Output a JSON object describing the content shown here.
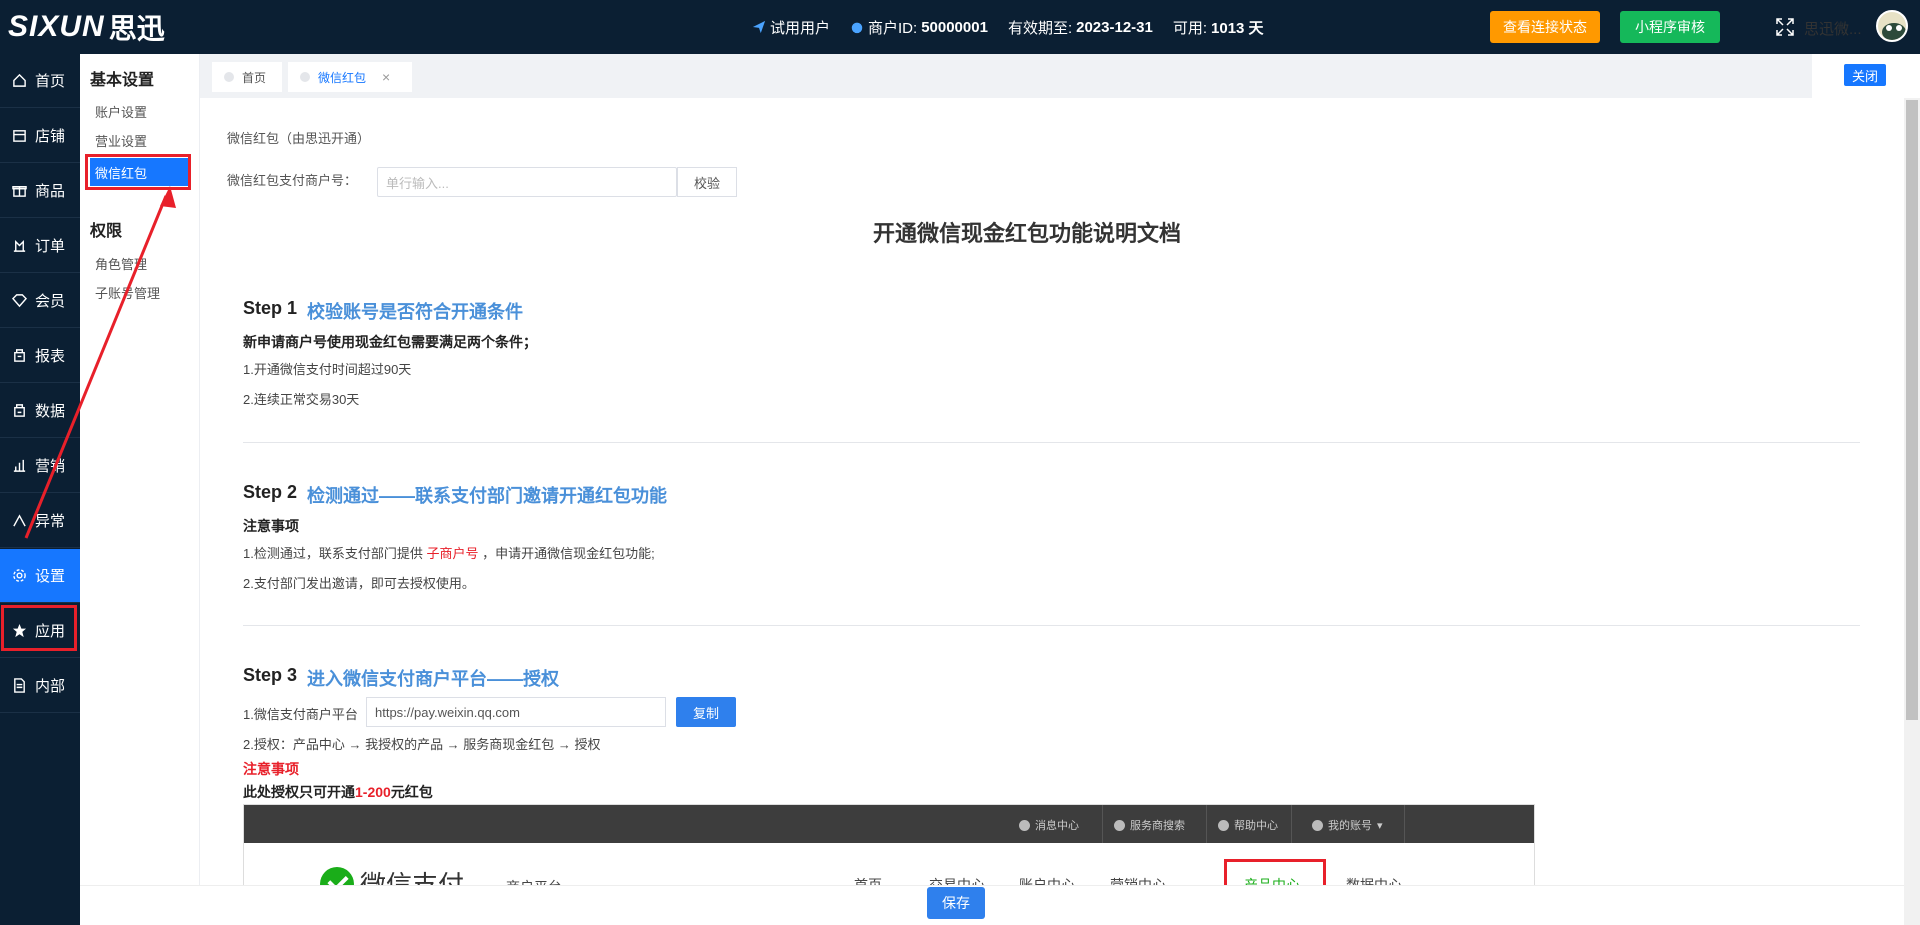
{
  "brand": {
    "logo_text": "SIXUN",
    "logo_cn": "思迅"
  },
  "topbar": {
    "user_type": "试用用户",
    "merchant_label": "商户ID:",
    "merchant_id": "50000001",
    "expire_label": "有效期至:",
    "expire_date": "2023-12-31",
    "available_label": "可用:",
    "available_days": "1013 天",
    "connection_button": "查看连接状态",
    "miniprogram_button": "小程序审核",
    "username": "思迅微..."
  },
  "leftnav": {
    "items": [
      {
        "label": "首页",
        "icon": "home-icon"
      },
      {
        "label": "店铺",
        "icon": "store-icon"
      },
      {
        "label": "商品",
        "icon": "gift-icon"
      },
      {
        "label": "订单",
        "icon": "order-icon"
      },
      {
        "label": "会员",
        "icon": "diamond-icon"
      },
      {
        "label": "报表",
        "icon": "report-icon"
      },
      {
        "label": "数据",
        "icon": "data-icon"
      },
      {
        "label": "营销",
        "icon": "chart-icon"
      },
      {
        "label": "异常",
        "icon": "warning-icon"
      },
      {
        "label": "设置",
        "icon": "gear-icon"
      },
      {
        "label": "应用",
        "icon": "star-icon"
      },
      {
        "label": "内部",
        "icon": "document-icon"
      }
    ],
    "active": "设置"
  },
  "subnav": {
    "section1": "基本设置",
    "account": "账户设置",
    "business": "营业设置",
    "redpacket": "微信红包",
    "section2": "权限",
    "role": "角色管理",
    "subaccount": "子账号管理"
  },
  "tabs": {
    "home": "首页",
    "current": "微信红包",
    "close_all": "关闭"
  },
  "form": {
    "page_title": "微信红包（由思迅开通）",
    "merchant_label": "微信红包支付商户号：",
    "merchant_placeholder": "单行输入...",
    "verify_button": "校验"
  },
  "doc": {
    "title": "开通微信现金红包功能说明文档",
    "step1": {
      "num": "Step 1",
      "title": "校验账号是否符合开通条件",
      "subtitle": "新申请商户号使用现金红包需要满足两个条件；",
      "line1": "1.开通微信支付时间超过90天",
      "line2": "2.连续正常交易30天"
    },
    "step2": {
      "num": "Step 2",
      "title": "检测通过——联系支付部门邀请开通红包功能",
      "subtitle": "注意事项",
      "line1_pre": "1.检测通过，联系支付部门提供",
      "line1_red": "子商户号",
      "line1_post": "，申请开通微信现金红包功能;",
      "line2": "2.支付部门发出邀请，即可去授权使用。"
    },
    "step3": {
      "num": "Step 3",
      "title": "进入微信支付商户平台——授权",
      "line1": "1.微信支付商户平台",
      "url": "https://pay.weixin.qq.com",
      "copy_button": "复制",
      "line2": "2.授权：产品中心 → 我授权的产品 → 服务商现金红包 → 授权",
      "note": "注意事项",
      "limit_pre": "此处授权只可开通",
      "limit_red": "1-200",
      "limit_post": "元红包"
    }
  },
  "embed": {
    "links": [
      "消息中心",
      "服务商搜索",
      "帮助中心",
      "我的账号"
    ],
    "brand": "微信支付",
    "platform": "商户平台",
    "nav": [
      "首页",
      "交易中心",
      "账户中心",
      "营销中心",
      "产品中心",
      "数据中心"
    ]
  },
  "save_button": "保存",
  "colors": {
    "primary": "#1677ff",
    "nav_bg": "#0b1f33",
    "orange": "#ff9900",
    "green": "#15b85a",
    "highlight_red": "#e8202a"
  }
}
